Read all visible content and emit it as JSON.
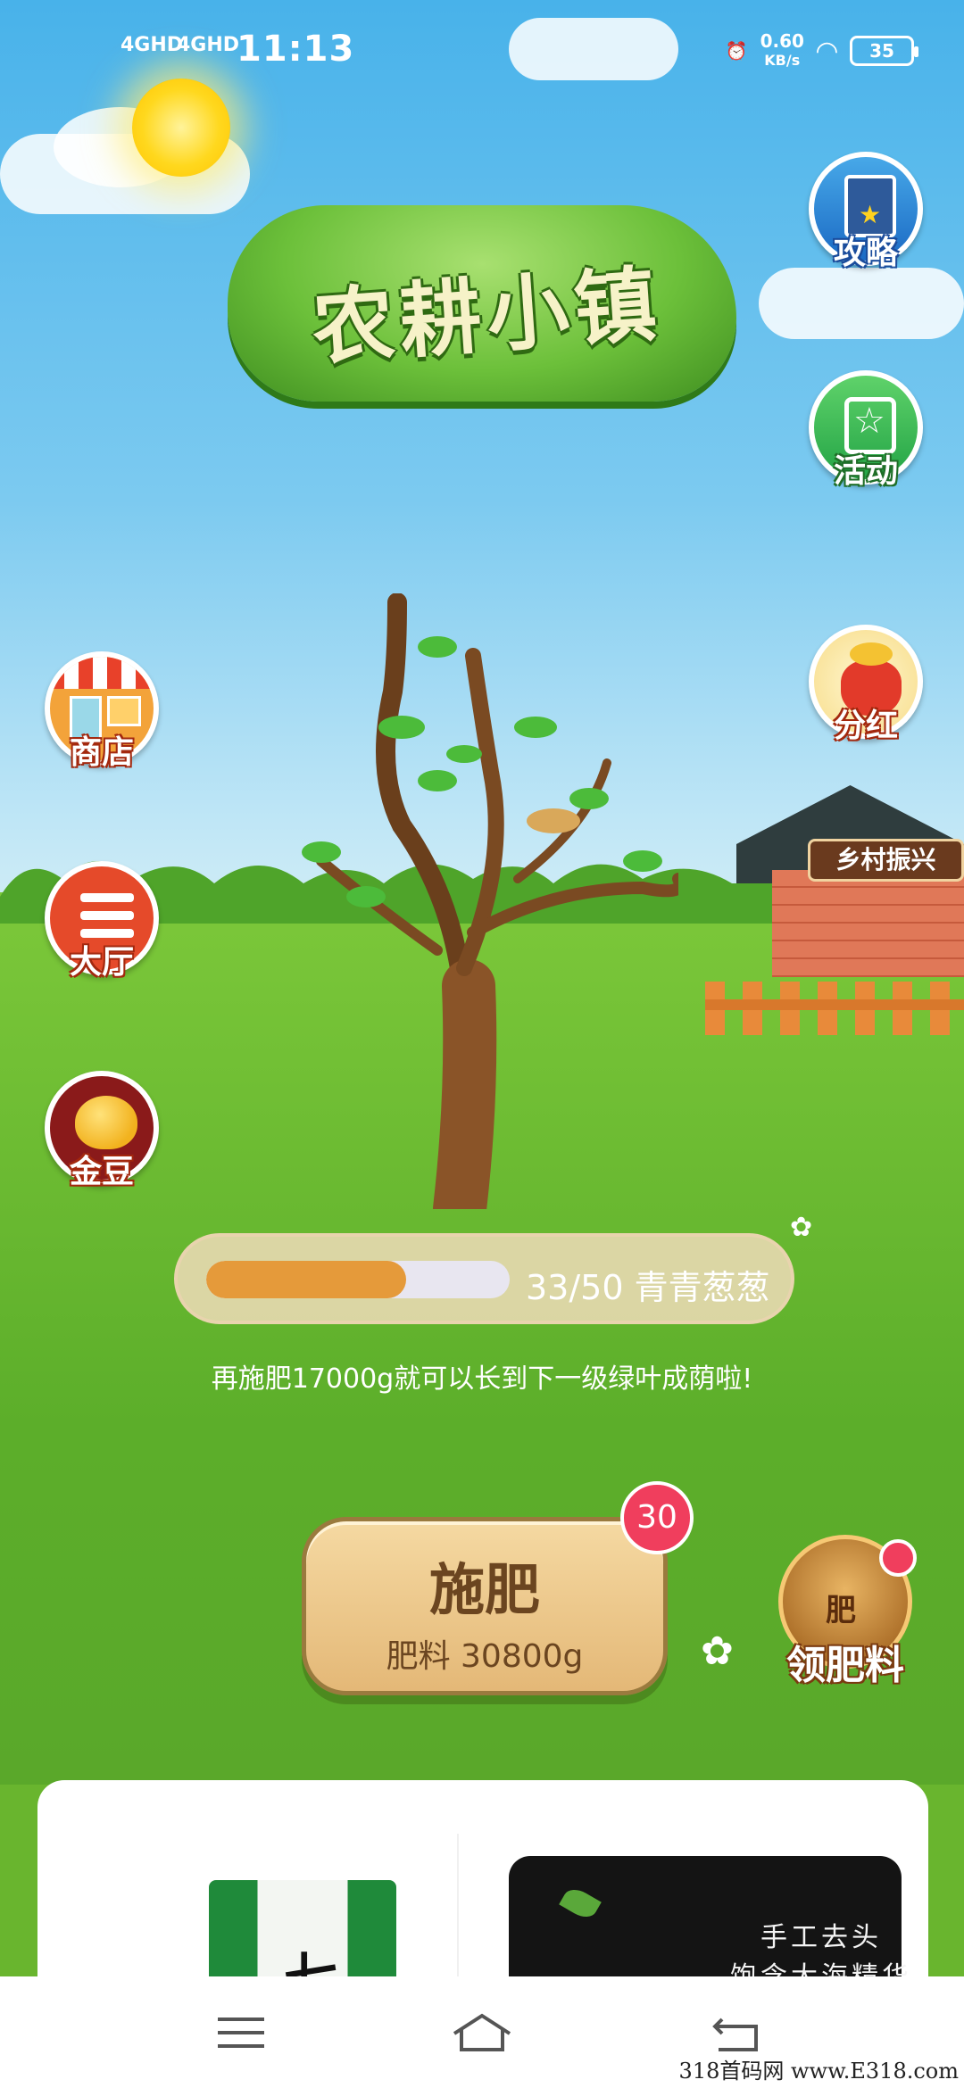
{
  "status_bar": {
    "signal1": "4GHD",
    "signal2": "4GHD",
    "time": "11:13",
    "net_speed_value": "0.60",
    "net_speed_unit": "KB/s",
    "battery": "35"
  },
  "game": {
    "title": "农耕小镇",
    "side_left": [
      {
        "label": "商店",
        "icon": "shop-icon"
      },
      {
        "label": "大厅",
        "icon": "list-icon"
      },
      {
        "label": "金豆",
        "icon": "gold-bean-icon"
      }
    ],
    "side_right": [
      {
        "label": "攻略",
        "icon": "guide-book-icon"
      },
      {
        "label": "活动",
        "icon": "star-badge-icon"
      },
      {
        "label": "分红",
        "icon": "money-bag-icon"
      }
    ],
    "house_sign": "乡村振兴",
    "progress": {
      "current": 33,
      "total": 50,
      "fraction": 0.66,
      "text": "33/50 青青葱葱"
    },
    "hint": "再施肥17000g就可以长到下一级绿叶成荫啦!",
    "fertilize": {
      "title": "施肥",
      "subtitle": "肥料 30800g",
      "badge": "30"
    },
    "get_fertilizer": {
      "label": "领肥料",
      "bag_text": "肥"
    }
  },
  "ad_card": {
    "product_right_line1": "手工去头",
    "product_right_line2": "饱含大海精华",
    "product_left_mark": "七"
  },
  "navbar": {
    "items": [
      "menu-icon",
      "home-icon",
      "back-icon"
    ]
  },
  "watermark": "318首码网 www.E318.com",
  "colors": {
    "sky": "#48b2ea",
    "grass": "#69b52e",
    "progress_fill": "#e59a3a",
    "badge": "#f03e5d",
    "button_wood": "#e4b877"
  }
}
